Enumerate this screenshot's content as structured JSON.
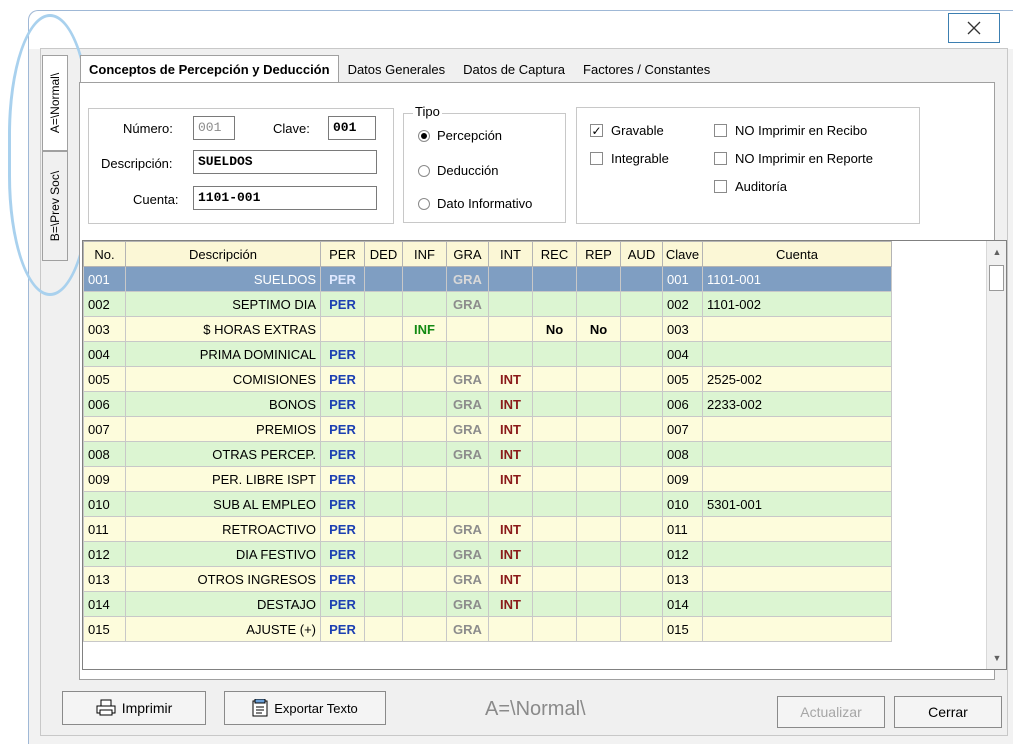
{
  "window": {
    "close_icon": "close-icon"
  },
  "side_tabs": [
    {
      "label": "A=\\Normal\\"
    },
    {
      "label": "B=\\Prev Soc\\"
    }
  ],
  "tabs": [
    {
      "label": "Conceptos de Percepción y Deducción"
    },
    {
      "label": "Datos Generales"
    },
    {
      "label": "Datos de Captura"
    },
    {
      "label": "Factores / Constantes"
    }
  ],
  "form": {
    "numero_label": "Número:",
    "numero_value": "001",
    "clave_label": "Clave:",
    "clave_value": "001",
    "descripcion_label": "Descripción:",
    "descripcion_value": "SUELDOS",
    "cuenta_label": "Cuenta:",
    "cuenta_value": "1101-001"
  },
  "tipo": {
    "title": "Tipo",
    "options": [
      "Percepción",
      "Deducción",
      "Dato Informativo"
    ],
    "selected": "Percepción"
  },
  "flags": {
    "gravable": {
      "label": "Gravable",
      "checked": true
    },
    "integrable": {
      "label": "Integrable",
      "checked": false
    },
    "no_imprimir_recibo": {
      "label": "NO Imprimir en Recibo",
      "checked": false
    },
    "no_imprimir_reporte": {
      "label": "NO Imprimir en Reporte",
      "checked": false
    },
    "auditoria": {
      "label": "Auditoría",
      "checked": false
    }
  },
  "grid": {
    "columns": [
      "No.",
      "Descripción",
      "PER",
      "DED",
      "INF",
      "GRA",
      "INT",
      "REC",
      "REP",
      "AUD",
      "Clave",
      "Cuenta"
    ],
    "rows": [
      [
        "001",
        "SUELDOS",
        "PER",
        "",
        "",
        "GRA",
        "",
        "",
        "",
        "",
        "001",
        "1101-001"
      ],
      [
        "002",
        "SEPTIMO DIA",
        "PER",
        "",
        "",
        "GRA",
        "",
        "",
        "",
        "",
        "002",
        "1101-002"
      ],
      [
        "003",
        "$ HORAS EXTRAS",
        "",
        "",
        "INF",
        "",
        "",
        "No",
        "No",
        "",
        "003",
        ""
      ],
      [
        "004",
        "PRIMA DOMINICAL",
        "PER",
        "",
        "",
        "",
        "",
        "",
        "",
        "",
        "004",
        ""
      ],
      [
        "005",
        "COMISIONES",
        "PER",
        "",
        "",
        "GRA",
        "INT",
        "",
        "",
        "",
        "005",
        "2525-002"
      ],
      [
        "006",
        "BONOS",
        "PER",
        "",
        "",
        "GRA",
        "INT",
        "",
        "",
        "",
        "006",
        "2233-002"
      ],
      [
        "007",
        "PREMIOS",
        "PER",
        "",
        "",
        "GRA",
        "INT",
        "",
        "",
        "",
        "007",
        ""
      ],
      [
        "008",
        "OTRAS PERCEP.",
        "PER",
        "",
        "",
        "GRA",
        "INT",
        "",
        "",
        "",
        "008",
        ""
      ],
      [
        "009",
        "PER. LIBRE ISPT",
        "PER",
        "",
        "",
        "",
        "INT",
        "",
        "",
        "",
        "009",
        ""
      ],
      [
        "010",
        "SUB AL EMPLEO",
        "PER",
        "",
        "",
        "",
        "",
        "",
        "",
        "",
        "010",
        "5301-001"
      ],
      [
        "011",
        "RETROACTIVO",
        "PER",
        "",
        "",
        "GRA",
        "INT",
        "",
        "",
        "",
        "011",
        ""
      ],
      [
        "012",
        "DIA FESTIVO",
        "PER",
        "",
        "",
        "GRA",
        "INT",
        "",
        "",
        "",
        "012",
        ""
      ],
      [
        "013",
        "OTROS INGRESOS",
        "PER",
        "",
        "",
        "GRA",
        "INT",
        "",
        "",
        "",
        "013",
        ""
      ],
      [
        "014",
        "DESTAJO",
        "PER",
        "",
        "",
        "GRA",
        "INT",
        "",
        "",
        "",
        "014",
        ""
      ],
      [
        "015",
        "AJUSTE (+)",
        "PER",
        "",
        "",
        "GRA",
        "",
        "",
        "",
        "",
        "015",
        ""
      ]
    ],
    "selected_row": 0
  },
  "footer": {
    "imprimir_label": "Imprimir",
    "exportar_label": "Exportar Texto",
    "status": "A=\\Normal\\",
    "actualizar_label": "Actualizar",
    "cerrar_label": "Cerrar"
  },
  "colors": {
    "per": "#1c3fb2",
    "inf": "#128a12",
    "gra": "#8c8c8c",
    "int": "#8a1a1a",
    "row_odd": "#fdfcdc",
    "row_even": "#dcf5d2",
    "row_selected": "#7f9ec2",
    "header": "#fbf7d6"
  }
}
